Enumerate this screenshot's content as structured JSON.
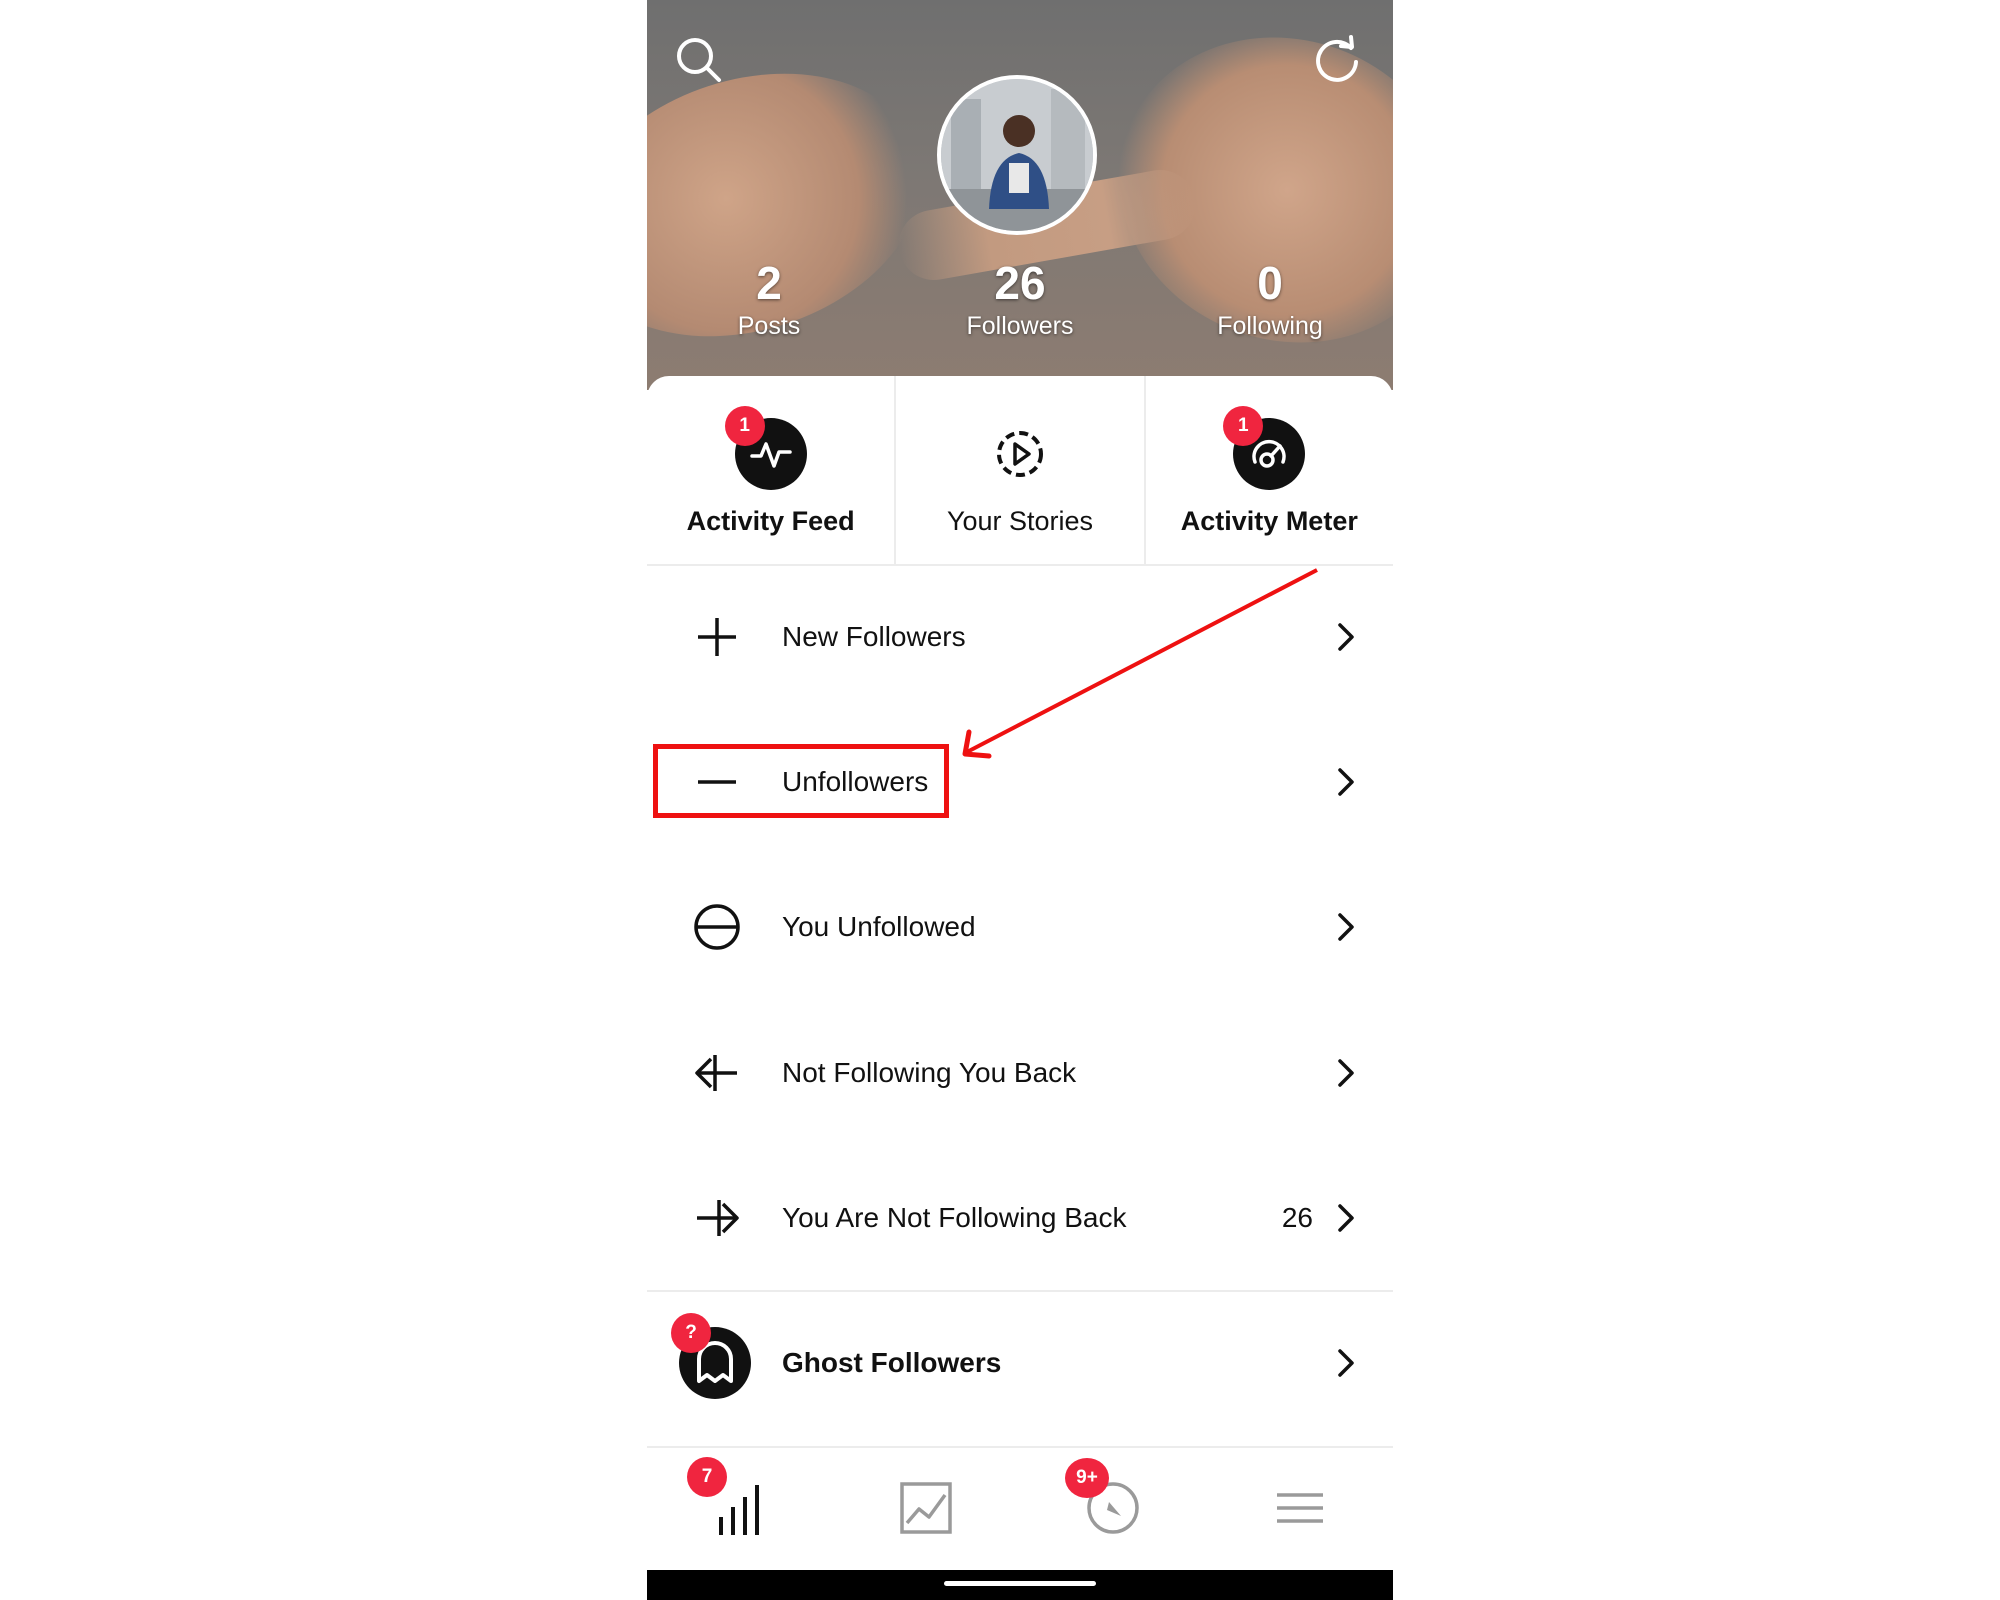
{
  "profile": {
    "stats": [
      {
        "value": "2",
        "label": "Posts"
      },
      {
        "value": "26",
        "label": "Followers"
      },
      {
        "value": "0",
        "label": "Following"
      }
    ]
  },
  "header": {
    "search_icon": "search-icon",
    "refresh_icon": "refresh-icon"
  },
  "tabs": [
    {
      "label": "Activity Feed",
      "badge": "1",
      "icon": "activity-pulse-icon"
    },
    {
      "label": "Your Stories",
      "badge": "",
      "icon": "story-play-icon"
    },
    {
      "label": "Activity Meter",
      "badge": "1",
      "icon": "meter-gauge-icon"
    }
  ],
  "menu": [
    {
      "label": "New Followers",
      "icon": "plus-icon",
      "count": ""
    },
    {
      "label": "Unfollowers",
      "icon": "minus-icon",
      "count": ""
    },
    {
      "label": "You Unfollowed",
      "icon": "circle-minus-icon",
      "count": ""
    },
    {
      "label": "Not Following You Back",
      "icon": "arrow-left-bar-icon",
      "count": ""
    },
    {
      "label": "You Are Not Following Back",
      "icon": "arrow-right-bar-icon",
      "count": "26"
    }
  ],
  "ghost": {
    "label": "Ghost Followers",
    "badge": "?",
    "icon": "ghost-icon"
  },
  "bottom_nav": [
    {
      "icon": "stats-bars-icon",
      "badge": "7"
    },
    {
      "icon": "chart-image-icon",
      "badge": ""
    },
    {
      "icon": "compass-icon",
      "badge": "9+"
    },
    {
      "icon": "hamburger-menu-icon",
      "badge": ""
    }
  ],
  "colors": {
    "badge": "#f0253f",
    "annotation": "#ee1111",
    "text": "#111111"
  }
}
